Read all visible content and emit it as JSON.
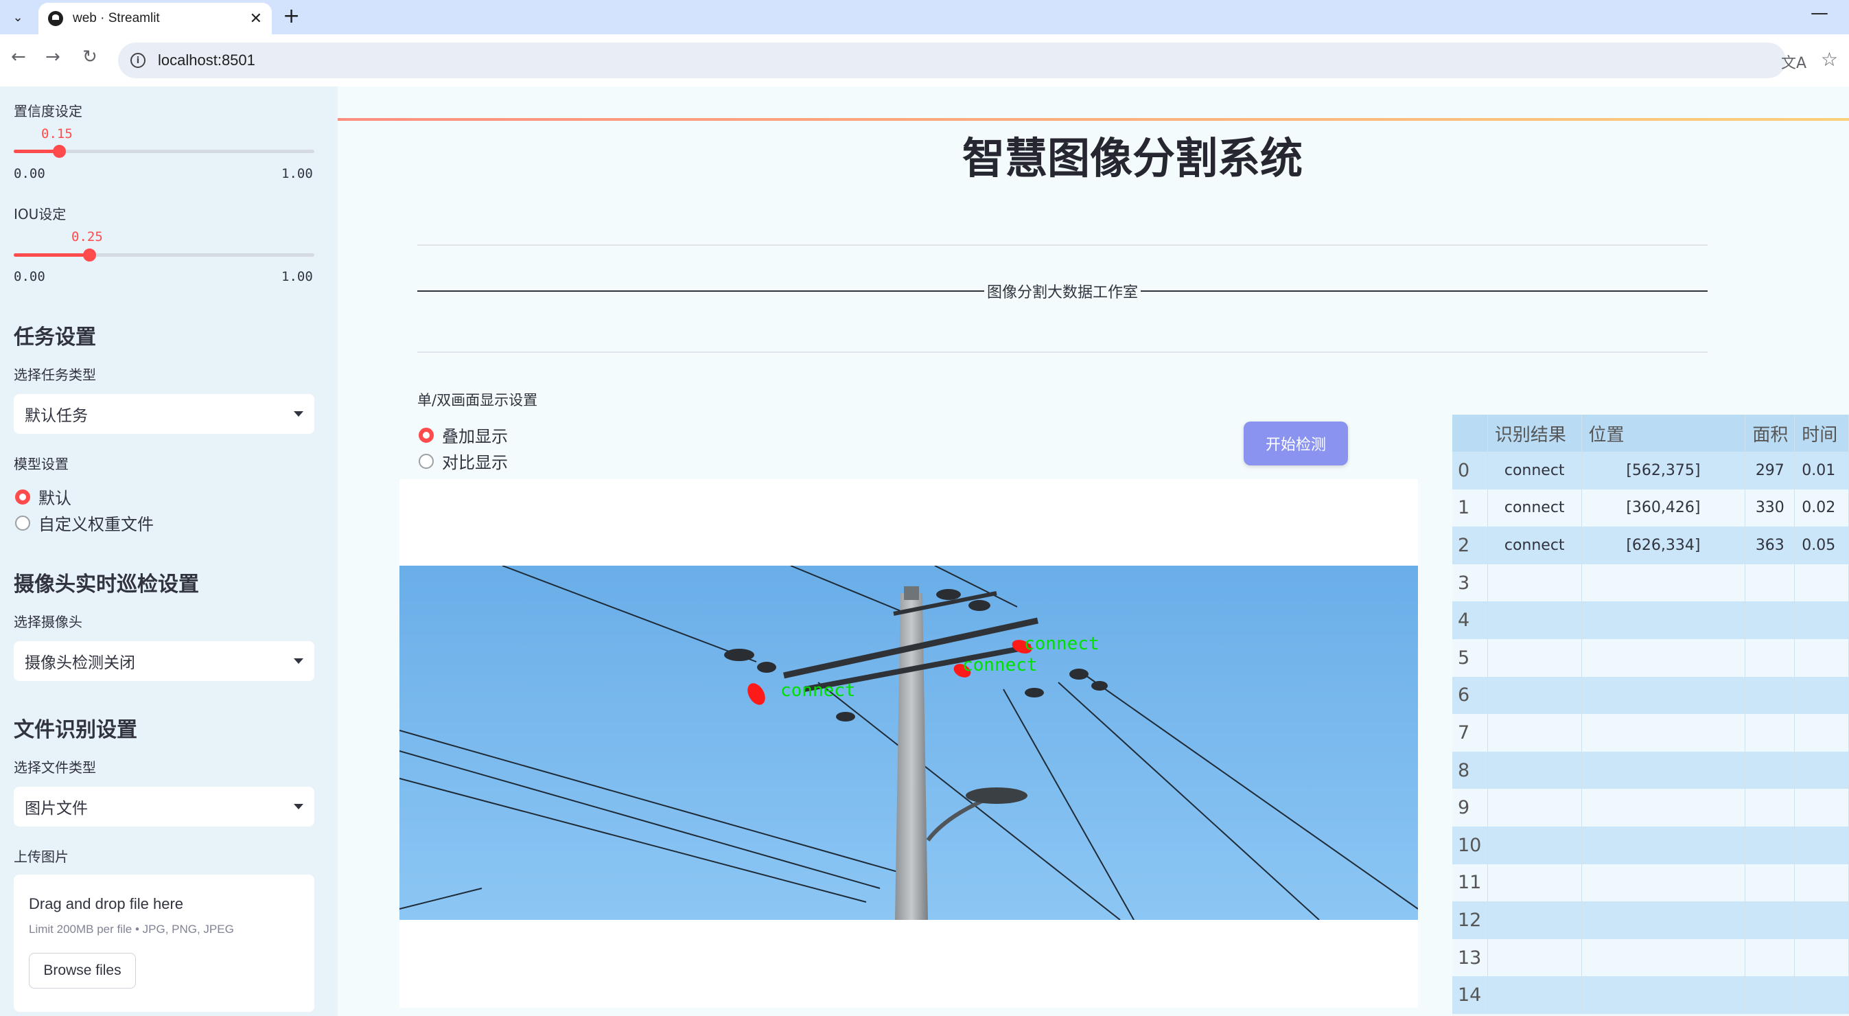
{
  "browser": {
    "tab_title": "web · Streamlit",
    "url": "localhost:8501"
  },
  "sidebar": {
    "confidence": {
      "label": "置信度设定",
      "value": "0.15",
      "min": "0.00",
      "max": "1.00",
      "fraction": 0.15
    },
    "iou": {
      "label": "IOU设定",
      "value": "0.25",
      "min": "0.00",
      "max": "1.00",
      "fraction": 0.25
    },
    "task_heading": "任务设置",
    "task_type_label": "选择任务类型",
    "task_type_value": "默认任务",
    "model_label": "模型设置",
    "model_options": [
      "默认",
      "自定义权重文件"
    ],
    "camera_heading": "摄像头实时巡检设置",
    "camera_label": "选择摄像头",
    "camera_value": "摄像头检测关闭",
    "file_heading": "文件识别设置",
    "file_type_label": "选择文件类型",
    "file_type_value": "图片文件",
    "upload_label": "上传图片",
    "upload": {
      "title": "Drag and drop file here",
      "limit": "Limit 200MB per file • JPG, PNG, JPEG",
      "button": "Browse files"
    }
  },
  "main": {
    "title": "智慧图像分割系统",
    "subtitle": "图像分割大数据工作室",
    "display_label": "单/双画面显示设置",
    "display_options": [
      "叠加显示",
      "对比显示"
    ],
    "start_button": "开始检测",
    "detections": [
      "connect",
      "connect",
      "connect"
    ]
  },
  "table": {
    "headers": [
      "识别结果",
      "位置",
      "面积",
      "时间"
    ],
    "rows": [
      [
        "0",
        "connect",
        "[562,375]",
        "297",
        "0.01"
      ],
      [
        "1",
        "connect",
        "[360,426]",
        "330",
        "0.02"
      ],
      [
        "2",
        "connect",
        "[626,334]",
        "363",
        "0.05"
      ],
      [
        "3",
        "",
        "",
        "",
        ""
      ],
      [
        "4",
        "",
        "",
        "",
        ""
      ],
      [
        "5",
        "",
        "",
        "",
        ""
      ],
      [
        "6",
        "",
        "",
        "",
        ""
      ],
      [
        "7",
        "",
        "",
        "",
        ""
      ],
      [
        "8",
        "",
        "",
        "",
        ""
      ],
      [
        "9",
        "",
        "",
        "",
        ""
      ],
      [
        "10",
        "",
        "",
        "",
        ""
      ],
      [
        "11",
        "",
        "",
        "",
        ""
      ],
      [
        "12",
        "",
        "",
        "",
        ""
      ],
      [
        "13",
        "",
        "",
        "",
        ""
      ],
      [
        "14",
        "",
        "",
        "",
        ""
      ]
    ]
  },
  "colors": {
    "accent": "#ff4b4b",
    "button": "#8a94f0",
    "sky": "#7fbef2",
    "mask": "#ff1a1a",
    "label": "#00e000"
  }
}
